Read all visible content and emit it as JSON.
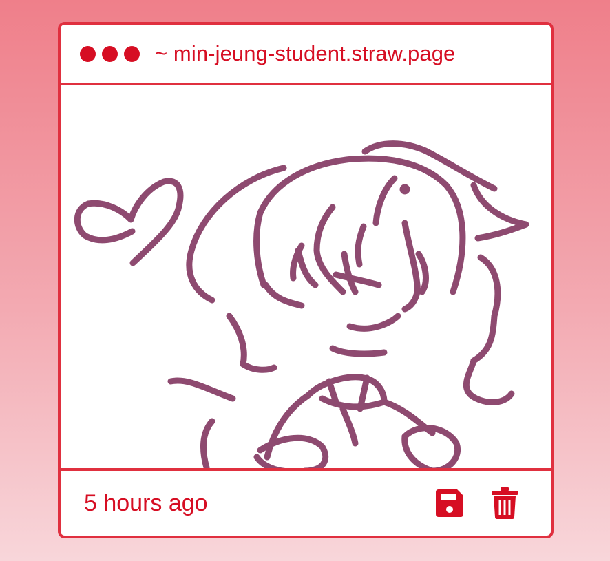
{
  "window": {
    "url": "~ min-jeung-student.straw.page"
  },
  "footer": {
    "timestamp": "5 hours ago"
  },
  "icons": {
    "title_dots": [
      "window-dot-icon",
      "window-dot-icon",
      "window-dot-icon"
    ],
    "save": "floppy-save-icon",
    "delete": "trash-icon"
  },
  "colors": {
    "accent": "#d60e23",
    "border": "#e0303f",
    "drawing_stroke": "#8e4a70",
    "background_top": "#ef7f8a",
    "background_bottom": "#f8d6da"
  }
}
